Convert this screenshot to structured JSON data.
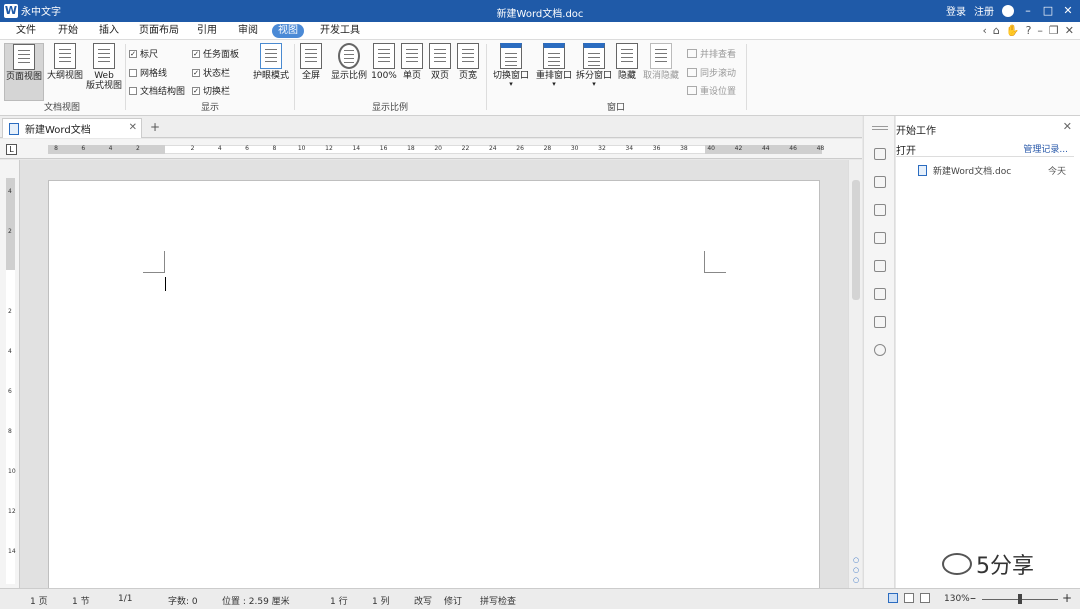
{
  "app": {
    "name": "永中文字",
    "doc_title": "新建Word文档.doc"
  },
  "titlebar": {
    "login": "登录",
    "register": "注册"
  },
  "menu": {
    "tabs": [
      "文件",
      "开始",
      "插入",
      "页面布局",
      "引用",
      "审阅",
      "视图",
      "开发工具"
    ],
    "active": "视图"
  },
  "ribbon": {
    "doc_view": {
      "label": "文档视图",
      "page_view": "页面视图",
      "outline_view": "大纲视图",
      "web_view_1": "Web",
      "web_view_2": "版式视图"
    },
    "show": {
      "label": "显示",
      "ruler": "标尺",
      "gridlines": "网格线",
      "doc_structure": "文档结构图",
      "task_pane": "任务面板",
      "status_bar": "状态栏",
      "switch_bar": "切换栏",
      "eye_mode": "护眼模式"
    },
    "zoom": {
      "label": "显示比例",
      "fullscreen": "全屏",
      "zoom": "显示比例",
      "zoom100": "100%",
      "single_page": "单页",
      "two_pages": "双页",
      "page_width": "页宽"
    },
    "window": {
      "label": "窗口",
      "switch_window": "切换窗口",
      "arrange": "重排窗口",
      "split": "拆分窗口",
      "hide": "隐藏",
      "unhide": "取消隐藏",
      "side_by_side": "并排查看",
      "sync_scroll": "同步滚动",
      "reset_position": "重设位置"
    }
  },
  "doc_tab": {
    "name": "新建Word文档"
  },
  "ruler": {
    "corner": "L",
    "ticks": [
      "8",
      "6",
      "4",
      "2",
      "",
      "2",
      "4",
      "6",
      "8",
      "10",
      "12",
      "14",
      "16",
      "18",
      "20",
      "22",
      "24",
      "26",
      "28",
      "30",
      "32",
      "34",
      "36",
      "38",
      "40",
      "42",
      "44",
      "46",
      "48"
    ],
    "vticks": [
      "4",
      "2",
      "",
      "2",
      "4",
      "6",
      "8",
      "10",
      "12",
      "14"
    ]
  },
  "taskpane": {
    "title": "开始工作",
    "open": "打开",
    "manage": "管理记录...",
    "recent_file": "新建Word文档.doc",
    "recent_date": "今天"
  },
  "watermark": "5分享",
  "statusbar": {
    "page": "1 页",
    "section": "1 节",
    "pages": "1/1",
    "words": "字数: 0",
    "position": "位置 : 2.59 厘米",
    "line": "1 行",
    "column": "1 列",
    "overwrite": "改写",
    "revise": "修订",
    "spellcheck": "拼写检查",
    "zoom": "130%"
  }
}
